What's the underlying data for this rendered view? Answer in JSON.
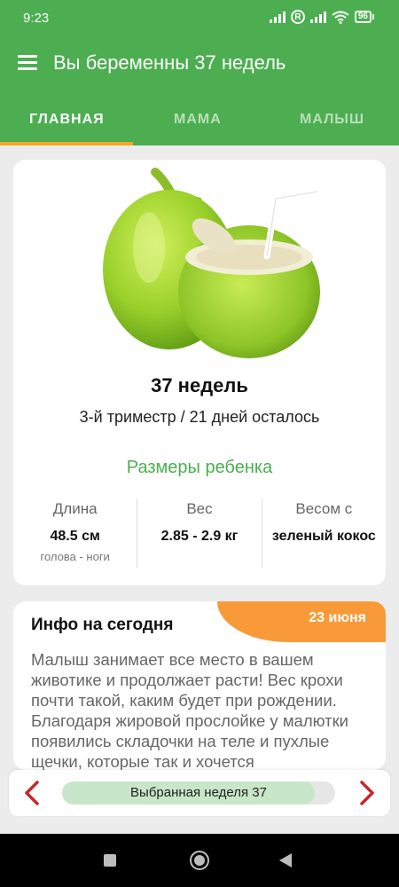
{
  "status": {
    "time": "9:23",
    "battery": "96",
    "r_badge": "R"
  },
  "appbar": {
    "title": "Вы беременны 37 недель"
  },
  "tabs": [
    {
      "label": "ГЛАВНАЯ",
      "active": true
    },
    {
      "label": "МАМА",
      "active": false
    },
    {
      "label": "МАЛЫШ",
      "active": false
    }
  ],
  "week_card": {
    "image": "green-coconut",
    "week": "37 недель",
    "trimester": "3-й триместр / 21 дней осталось",
    "sizes_title": "Размеры ребенка",
    "stats": [
      {
        "label": "Длина",
        "value": "48.5 см",
        "sub": "голова - ноги"
      },
      {
        "label": "Вес",
        "value": "2.85 - 2.9 кг",
        "sub": ""
      },
      {
        "label": "Весом с",
        "value": "зеленый кокос",
        "sub": ""
      }
    ]
  },
  "info_card": {
    "title": "Инфо на сегодня",
    "date": "23 июня",
    "text": "Малыш занимает все место в вашем животике и продолжает расти! Вес крохи почти такой, каким будет при рождении. Благодаря жировой прослойке у малютки появились складочки на теле и пухлые щечки, которые так и хочется"
  },
  "week_nav": {
    "label": "Выбранная неделя 37",
    "progress": 0.925,
    "prev_icon": "chevron-left-icon",
    "next_icon": "chevron-right-icon"
  },
  "colors": {
    "primary": "#4cae50",
    "accent": "#f5a623",
    "date_badge": "#f99a38",
    "arrow": "#c62828"
  }
}
